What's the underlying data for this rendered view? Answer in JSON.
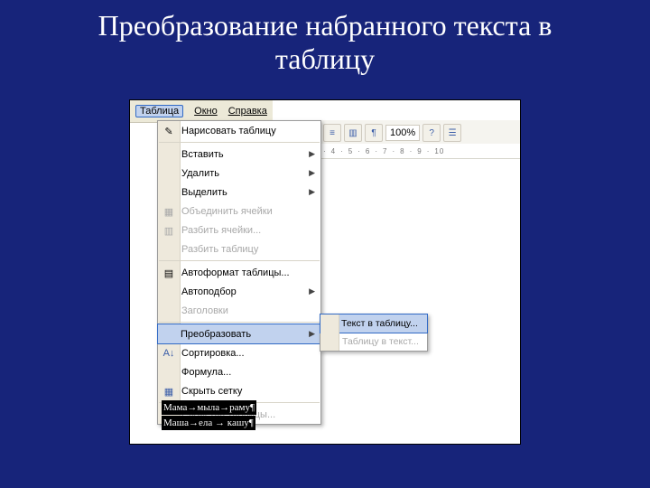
{
  "title_line1": "Преобразование набранного текста в",
  "title_line2": "таблицу",
  "menubar": {
    "table": "Таблица",
    "window": "Окно",
    "help": "Справка"
  },
  "toolbar": {
    "zoom": "100%"
  },
  "ruler": {
    "m4": "4",
    "m5": "5",
    "m6": "6",
    "m7": "7",
    "m8": "8",
    "m9": "9",
    "m10": "10"
  },
  "menu": {
    "draw": "Нарисовать таблицу",
    "insert": "Вставить",
    "delete": "Удалить",
    "select": "Выделить",
    "merge": "Объединить ячейки",
    "split": "Разбить ячейки...",
    "splittbl": "Разбить таблицу",
    "autofmt": "Автоформат таблицы...",
    "autofit": "Автоподбор",
    "headings": "Заголовки",
    "convert": "Преобразовать",
    "sort": "Сортировка...",
    "formula": "Формула...",
    "grid": "Скрыть сетку",
    "props": "Свойства таблицы..."
  },
  "submenu": {
    "t2t": "Текст в таблицу...",
    "tbl2t": "Таблицу в текст..."
  },
  "doc": {
    "l1": "Мама→мыла→раму¶",
    "l2": "Маша→ела → кашу¶"
  }
}
